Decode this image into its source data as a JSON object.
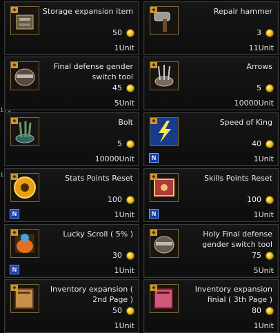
{
  "side_labels": [
    "irs",
    "its"
  ],
  "items": [
    {
      "name": "Storage expansion item",
      "price": "50",
      "unit": "1Unit",
      "badge": "",
      "icon": "chest-icon",
      "color": "#6b5a3a"
    },
    {
      "name": "Repair hammer",
      "price": "3",
      "unit": "11Unit",
      "badge": "",
      "icon": "hammer-icon",
      "color": "#6a6a6a"
    },
    {
      "name": "Final defense gender switch tool",
      "price": "45",
      "unit": "5Unit",
      "badge": "",
      "icon": "armor-icon",
      "color": "#5a4a3a"
    },
    {
      "name": "Arrows",
      "price": "5",
      "unit": "10000Unit",
      "badge": "",
      "icon": "arrows-icon",
      "color": "#5a4a38"
    },
    {
      "name": "Bolt",
      "price": "5",
      "unit": "10000Unit",
      "badge": "",
      "icon": "bolt-icon",
      "color": "#3a4a3a"
    },
    {
      "name": "Speed of King",
      "price": "40",
      "unit": "1Unit",
      "badge": "N",
      "icon": "lightning-icon",
      "color": "#2a4a8a"
    },
    {
      "name": "Stats Points Reset",
      "price": "100",
      "unit": "1Unit",
      "badge": "N",
      "icon": "orb-icon",
      "color": "#b87a10"
    },
    {
      "name": "Skills Points Reset",
      "price": "100",
      "unit": "1Unit",
      "badge": "N",
      "icon": "book-icon",
      "color": "#8a2a2a"
    },
    {
      "name": "Lucky Scroll ( 5% )",
      "price": "30",
      "unit": "1Unit",
      "badge": "N",
      "icon": "scroll-icon",
      "color": "#6a3a1a"
    },
    {
      "name": "Holy Final defense gender switch tool",
      "price": "75",
      "unit": "5Unit",
      "badge": "",
      "icon": "holy-armor-icon",
      "color": "#6a5a4a"
    },
    {
      "name": "Inventory expansion ( 2nd Page )",
      "price": "50",
      "unit": "1Unit",
      "badge": "",
      "icon": "bag-icon",
      "color": "#8a6a3a"
    },
    {
      "name": "Inventory expansion finial ( 3th Page )",
      "price": "80",
      "unit": "1Unit",
      "badge": "",
      "icon": "pink-bag-icon",
      "color": "#9a3a5a"
    }
  ]
}
